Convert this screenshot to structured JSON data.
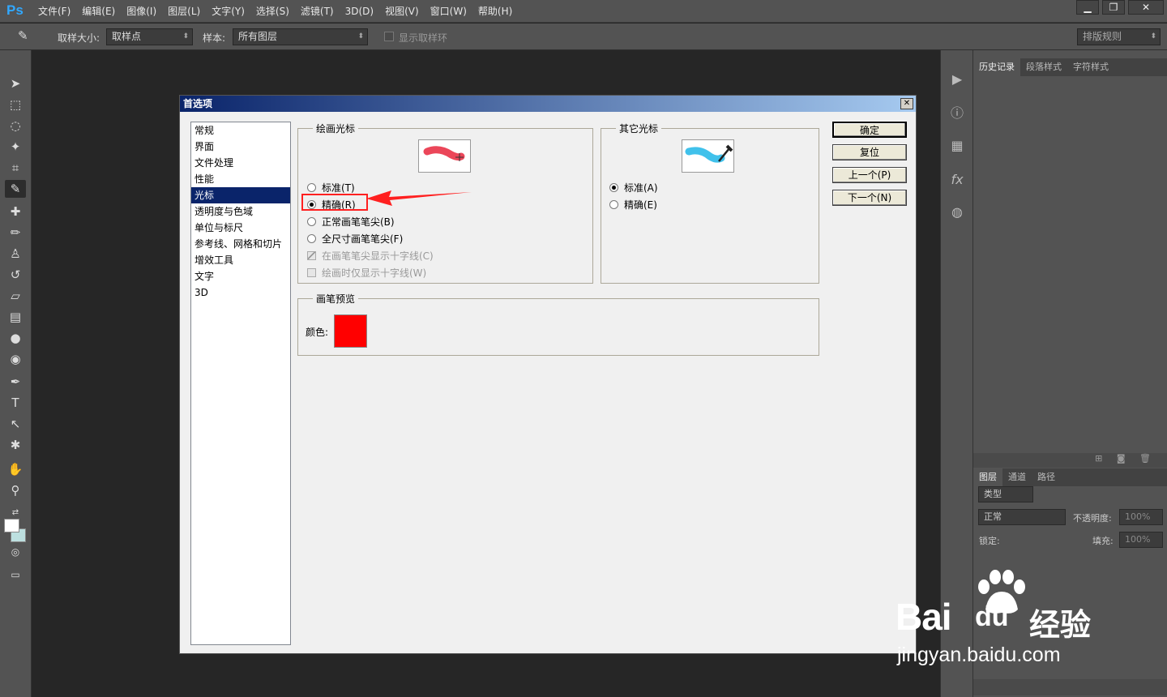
{
  "app": {
    "logo": "Ps"
  },
  "menubar": {
    "items": [
      "文件(F)",
      "编辑(E)",
      "图像(I)",
      "图层(L)",
      "文字(Y)",
      "选择(S)",
      "滤镜(T)",
      "3D(D)",
      "视图(V)",
      "窗口(W)",
      "帮助(H)"
    ]
  },
  "window_controls": {
    "minimize": "▁",
    "restore": "❐",
    "close": "✕"
  },
  "options_bar": {
    "sample_size_label": "取样大小:",
    "sample_size_value": "取样点",
    "sample_label": "样本:",
    "sample_value": "所有图层",
    "show_ring_label": "显示取样环",
    "workspace_value": "排版规则"
  },
  "history_panel": {
    "tabs": [
      "历史记录",
      "段落样式",
      "字符样式"
    ]
  },
  "layers_panel": {
    "tabs": [
      "图层",
      "通道",
      "路径"
    ],
    "filter_value": "类型",
    "blend_mode": "正常",
    "opacity_label": "不透明度:",
    "opacity_value": "100%",
    "lock_label": "锁定:",
    "fill_label": "填充:",
    "fill_value": "100%"
  },
  "dialog": {
    "title": "首选项",
    "close": "✕",
    "categories": [
      "常规",
      "界面",
      "文件处理",
      "性能",
      "光标",
      "透明度与色域",
      "单位与标尺",
      "参考线、网格和切片",
      "增效工具",
      "文字",
      "3D"
    ],
    "selected_category": "光标",
    "painting_cursors": {
      "legend": "绘画光标",
      "options": [
        "标准(T)",
        "精确(R)",
        "正常画笔笔尖(B)",
        "全尺寸画笔笔尖(F)"
      ],
      "selected": "精确(R)",
      "checkboxes": [
        "在画笔笔尖显示十字线(C)",
        "绘画时仅显示十字线(W)"
      ]
    },
    "other_cursors": {
      "legend": "其它光标",
      "options": [
        "标准(A)",
        "精确(E)"
      ],
      "selected": "标准(A)"
    },
    "brush_preview": {
      "legend": "画笔预览",
      "color_label": "颜色:",
      "color": "#ff0000"
    },
    "buttons": {
      "ok": "确定",
      "reset": "复位",
      "prev": "上一个(P)",
      "next": "下一个(N)"
    }
  },
  "watermark": {
    "brand": "Bai",
    "brand2": "du",
    "cn": "经验",
    "url": "jingyan.baidu.com"
  },
  "colors": {
    "accent": "#0a246a",
    "annotation": "#ff2020"
  }
}
